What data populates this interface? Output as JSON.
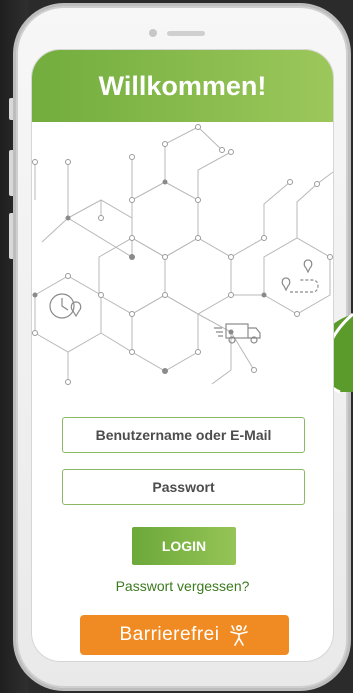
{
  "header": {
    "title": "Willkommen!"
  },
  "form": {
    "username_placeholder": "Benutzername oder E-Mail",
    "password_placeholder": "Passwort",
    "login_label": "LOGIN",
    "forgot_label": "Passwort vergessen?"
  },
  "accessibility": {
    "label": "Barrierefrei",
    "icon": "accessibility-person-icon"
  },
  "colors": {
    "header_gradient": [
      "#72ad3e",
      "#9cc75b"
    ],
    "accent_orange": "#f08a23",
    "link_green": "#3b7a1e"
  }
}
